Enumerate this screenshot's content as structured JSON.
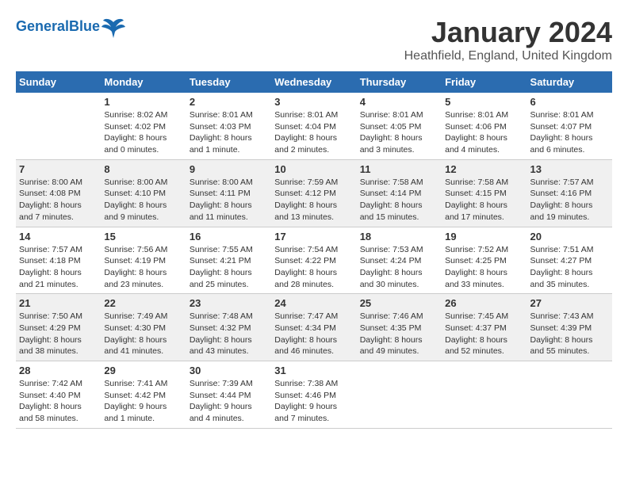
{
  "header": {
    "logo_general": "General",
    "logo_blue": "Blue",
    "month_year": "January 2024",
    "location": "Heathfield, England, United Kingdom"
  },
  "days_of_week": [
    "Sunday",
    "Monday",
    "Tuesday",
    "Wednesday",
    "Thursday",
    "Friday",
    "Saturday"
  ],
  "weeks": [
    {
      "row_class": "week-row-1",
      "days": [
        {
          "number": "",
          "info": ""
        },
        {
          "number": "1",
          "info": "Sunrise: 8:02 AM\nSunset: 4:02 PM\nDaylight: 8 hours\nand 0 minutes."
        },
        {
          "number": "2",
          "info": "Sunrise: 8:01 AM\nSunset: 4:03 PM\nDaylight: 8 hours\nand 1 minute."
        },
        {
          "number": "3",
          "info": "Sunrise: 8:01 AM\nSunset: 4:04 PM\nDaylight: 8 hours\nand 2 minutes."
        },
        {
          "number": "4",
          "info": "Sunrise: 8:01 AM\nSunset: 4:05 PM\nDaylight: 8 hours\nand 3 minutes."
        },
        {
          "number": "5",
          "info": "Sunrise: 8:01 AM\nSunset: 4:06 PM\nDaylight: 8 hours\nand 4 minutes."
        },
        {
          "number": "6",
          "info": "Sunrise: 8:01 AM\nSunset: 4:07 PM\nDaylight: 8 hours\nand 6 minutes."
        }
      ]
    },
    {
      "row_class": "week-row-2",
      "days": [
        {
          "number": "7",
          "info": "Sunrise: 8:00 AM\nSunset: 4:08 PM\nDaylight: 8 hours\nand 7 minutes."
        },
        {
          "number": "8",
          "info": "Sunrise: 8:00 AM\nSunset: 4:10 PM\nDaylight: 8 hours\nand 9 minutes."
        },
        {
          "number": "9",
          "info": "Sunrise: 8:00 AM\nSunset: 4:11 PM\nDaylight: 8 hours\nand 11 minutes."
        },
        {
          "number": "10",
          "info": "Sunrise: 7:59 AM\nSunset: 4:12 PM\nDaylight: 8 hours\nand 13 minutes."
        },
        {
          "number": "11",
          "info": "Sunrise: 7:58 AM\nSunset: 4:14 PM\nDaylight: 8 hours\nand 15 minutes."
        },
        {
          "number": "12",
          "info": "Sunrise: 7:58 AM\nSunset: 4:15 PM\nDaylight: 8 hours\nand 17 minutes."
        },
        {
          "number": "13",
          "info": "Sunrise: 7:57 AM\nSunset: 4:16 PM\nDaylight: 8 hours\nand 19 minutes."
        }
      ]
    },
    {
      "row_class": "week-row-3",
      "days": [
        {
          "number": "14",
          "info": "Sunrise: 7:57 AM\nSunset: 4:18 PM\nDaylight: 8 hours\nand 21 minutes."
        },
        {
          "number": "15",
          "info": "Sunrise: 7:56 AM\nSunset: 4:19 PM\nDaylight: 8 hours\nand 23 minutes."
        },
        {
          "number": "16",
          "info": "Sunrise: 7:55 AM\nSunset: 4:21 PM\nDaylight: 8 hours\nand 25 minutes."
        },
        {
          "number": "17",
          "info": "Sunrise: 7:54 AM\nSunset: 4:22 PM\nDaylight: 8 hours\nand 28 minutes."
        },
        {
          "number": "18",
          "info": "Sunrise: 7:53 AM\nSunset: 4:24 PM\nDaylight: 8 hours\nand 30 minutes."
        },
        {
          "number": "19",
          "info": "Sunrise: 7:52 AM\nSunset: 4:25 PM\nDaylight: 8 hours\nand 33 minutes."
        },
        {
          "number": "20",
          "info": "Sunrise: 7:51 AM\nSunset: 4:27 PM\nDaylight: 8 hours\nand 35 minutes."
        }
      ]
    },
    {
      "row_class": "week-row-4",
      "days": [
        {
          "number": "21",
          "info": "Sunrise: 7:50 AM\nSunset: 4:29 PM\nDaylight: 8 hours\nand 38 minutes."
        },
        {
          "number": "22",
          "info": "Sunrise: 7:49 AM\nSunset: 4:30 PM\nDaylight: 8 hours\nand 41 minutes."
        },
        {
          "number": "23",
          "info": "Sunrise: 7:48 AM\nSunset: 4:32 PM\nDaylight: 8 hours\nand 43 minutes."
        },
        {
          "number": "24",
          "info": "Sunrise: 7:47 AM\nSunset: 4:34 PM\nDaylight: 8 hours\nand 46 minutes."
        },
        {
          "number": "25",
          "info": "Sunrise: 7:46 AM\nSunset: 4:35 PM\nDaylight: 8 hours\nand 49 minutes."
        },
        {
          "number": "26",
          "info": "Sunrise: 7:45 AM\nSunset: 4:37 PM\nDaylight: 8 hours\nand 52 minutes."
        },
        {
          "number": "27",
          "info": "Sunrise: 7:43 AM\nSunset: 4:39 PM\nDaylight: 8 hours\nand 55 minutes."
        }
      ]
    },
    {
      "row_class": "week-row-5",
      "days": [
        {
          "number": "28",
          "info": "Sunrise: 7:42 AM\nSunset: 4:40 PM\nDaylight: 8 hours\nand 58 minutes."
        },
        {
          "number": "29",
          "info": "Sunrise: 7:41 AM\nSunset: 4:42 PM\nDaylight: 9 hours\nand 1 minute."
        },
        {
          "number": "30",
          "info": "Sunrise: 7:39 AM\nSunset: 4:44 PM\nDaylight: 9 hours\nand 4 minutes."
        },
        {
          "number": "31",
          "info": "Sunrise: 7:38 AM\nSunset: 4:46 PM\nDaylight: 9 hours\nand 7 minutes."
        },
        {
          "number": "",
          "info": ""
        },
        {
          "number": "",
          "info": ""
        },
        {
          "number": "",
          "info": ""
        }
      ]
    }
  ]
}
